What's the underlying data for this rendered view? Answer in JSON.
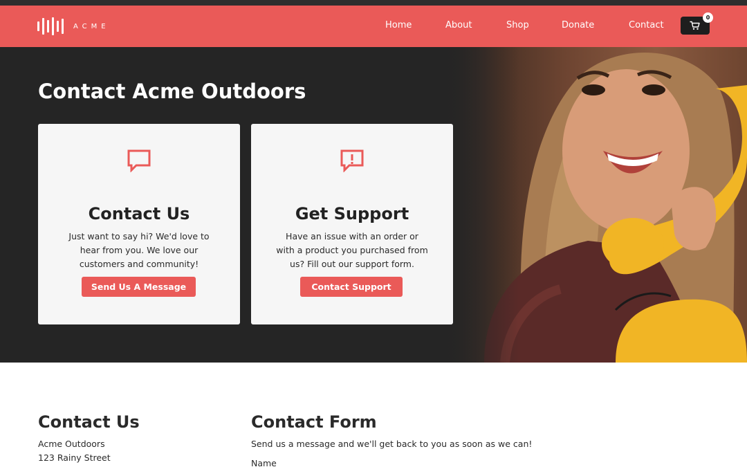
{
  "brand": {
    "name": "ACME",
    "accent": "#ea5a58",
    "dark": "#252525"
  },
  "nav": {
    "items": [
      {
        "label": "Home"
      },
      {
        "label": "About"
      },
      {
        "label": "Shop"
      },
      {
        "label": "Donate"
      },
      {
        "label": "Contact"
      }
    ],
    "cart": {
      "icon": "cart-icon",
      "count": "0"
    }
  },
  "hero": {
    "title": "Contact Acme Outdoors",
    "image": "woman-on-yellow-phone-photo",
    "cards": [
      {
        "icon": "chat-bubble-icon",
        "title": "Contact Us",
        "desc": "Just want to say hi? We'd love to hear from you. We love our customers and community!",
        "button": "Send Us A Message"
      },
      {
        "icon": "alert-bubble-icon",
        "title": "Get Support",
        "desc": "Have an issue with an order or with a product you purchased from us? Fill out our support form.",
        "button": "Contact Support"
      }
    ]
  },
  "contact_info": {
    "title": "Contact Us",
    "lines": [
      "Acme Outdoors",
      "123 Rainy Street"
    ]
  },
  "contact_form": {
    "title": "Contact Form",
    "subtitle": "Send us a message and we'll get back to you as soon as we can!",
    "name_label": "Name"
  }
}
